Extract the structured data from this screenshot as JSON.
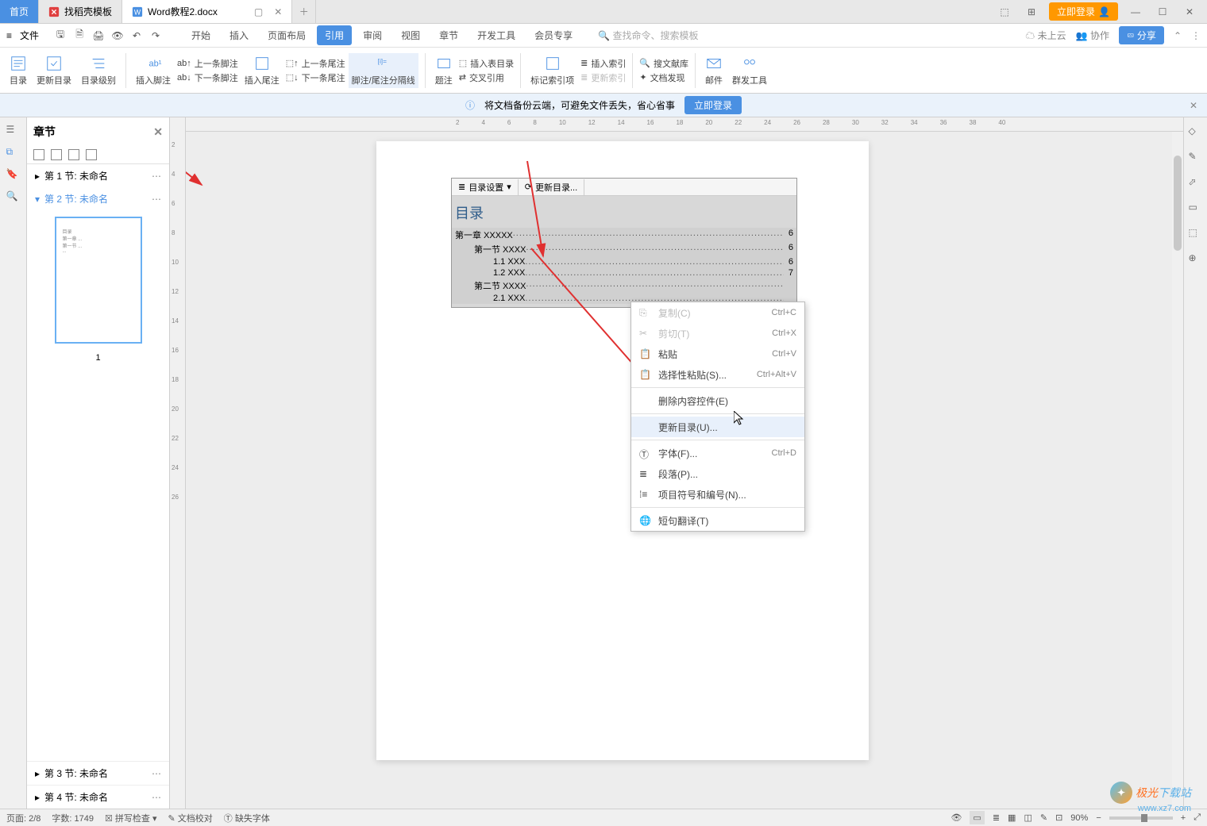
{
  "titlebar": {
    "home": "首页",
    "template_tab": "找稻壳模板",
    "doc_tab": "Word教程2.docx",
    "login": "立即登录"
  },
  "menubar": {
    "file": "文件",
    "tabs": {
      "start": "开始",
      "insert": "插入",
      "layout": "页面布局",
      "ref": "引用",
      "review": "审阅",
      "view": "视图",
      "section": "章节",
      "dev": "开发工具",
      "member": "会员专享"
    },
    "search_placeholder": "查找命令、搜索模板",
    "not_cloud": "未上云",
    "collab": "协作",
    "share": "分享"
  },
  "ribbon": {
    "toc": "目录",
    "update_toc": "更新目录",
    "toc_level": "目录级别",
    "insert_footnote": "插入脚注",
    "prev_footnote": "上一条脚注",
    "next_footnote": "下一条脚注",
    "insert_endnote": "插入尾注",
    "prev_endnote": "上一条尾注",
    "next_endnote": "下一条尾注",
    "separator": "脚注/尾注分隔线",
    "caption": "题注",
    "insert_figtable": "插入表目录",
    "cross_ref": "交叉引用",
    "mark_index": "标记索引项",
    "insert_index": "插入索引",
    "update_index": "更新索引",
    "search_lib": "搜文献库",
    "doc_discover": "文档发现",
    "mail": "邮件",
    "group_tools": "群发工具"
  },
  "infobar": {
    "text": "将文档备份云端，可避免文件丢失，省心省事",
    "login": "立即登录"
  },
  "ruler_h": [
    "2",
    "4",
    "6",
    "8",
    "10",
    "12",
    "14",
    "16",
    "18",
    "20",
    "22",
    "24",
    "26",
    "28",
    "30",
    "32",
    "34",
    "36",
    "38",
    "40"
  ],
  "ruler_v": [
    "2",
    "4",
    "6",
    "8",
    "10",
    "12",
    "14",
    "16",
    "18",
    "20",
    "22",
    "24",
    "26"
  ],
  "panel": {
    "title": "章节",
    "sections": {
      "s1": "第 1 节: 未命名",
      "s2": "第 2 节: 未命名",
      "s3": "第 3 节: 未命名",
      "s4": "第 4 节: 未命名"
    },
    "thumb_label": "1"
  },
  "toc_field": {
    "btn_settings": "目录设置",
    "btn_update": "更新目录...",
    "title": "目录",
    "lines": [
      {
        "indent": 0,
        "text": "第一章 XXXXX",
        "page": "6"
      },
      {
        "indent": 1,
        "text": "第一节 XXXX",
        "page": "6"
      },
      {
        "indent": 2,
        "text": "1.1 XXX",
        "page": "6"
      },
      {
        "indent": 2,
        "text": "1.2 XXX",
        "page": "7"
      },
      {
        "indent": 1,
        "text": "第二节 XXXX",
        "page": ""
      },
      {
        "indent": 2,
        "text": "2.1 XXX",
        "page": ""
      }
    ]
  },
  "context_menu": {
    "copy": "复制(C)",
    "copy_sc": "Ctrl+C",
    "cut": "剪切(T)",
    "cut_sc": "Ctrl+X",
    "paste": "粘贴",
    "paste_sc": "Ctrl+V",
    "paste_special": "选择性粘贴(S)...",
    "paste_special_sc": "Ctrl+Alt+V",
    "delete_ctrl": "删除内容控件(E)",
    "update_toc": "更新目录(U)...",
    "font": "字体(F)...",
    "font_sc": "Ctrl+D",
    "paragraph": "段落(P)...",
    "bullets": "项目符号和编号(N)...",
    "translate": "短句翻译(T)"
  },
  "statusbar": {
    "page": "页面: 2/8",
    "words": "字数: 1749",
    "spell": "拼写检查",
    "proof": "文档校对",
    "missing": "缺失字体",
    "zoom": "90%"
  },
  "watermark": {
    "text1": "极光",
    "text2": "下载站",
    "url": "www.xz7.com"
  }
}
